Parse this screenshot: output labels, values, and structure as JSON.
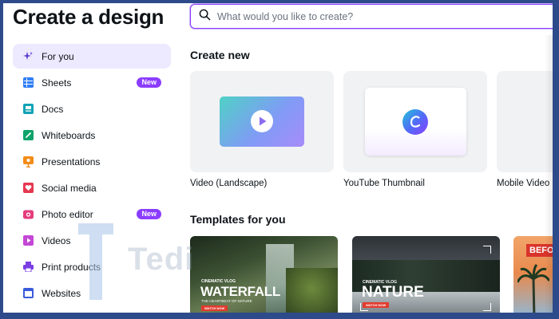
{
  "page": {
    "title": "Create a design"
  },
  "search": {
    "placeholder": "What would you like to create?"
  },
  "sidebar": {
    "items": [
      {
        "label": "For you",
        "icon": "sparkle-icon",
        "active": true
      },
      {
        "label": "Sheets",
        "icon": "sheets-icon",
        "badge": "New"
      },
      {
        "label": "Docs",
        "icon": "docs-icon"
      },
      {
        "label": "Whiteboards",
        "icon": "whiteboard-icon"
      },
      {
        "label": "Presentations",
        "icon": "presentation-icon"
      },
      {
        "label": "Social media",
        "icon": "heart-icon"
      },
      {
        "label": "Photo editor",
        "icon": "camera-icon",
        "badge": "New"
      },
      {
        "label": "Videos",
        "icon": "video-icon"
      },
      {
        "label": "Print products",
        "icon": "printer-icon"
      },
      {
        "label": "Websites",
        "icon": "website-icon"
      }
    ]
  },
  "create_new": {
    "heading": "Create new",
    "cards": [
      {
        "label": "Video (Landscape)"
      },
      {
        "label": "YouTube Thumbnail"
      },
      {
        "label": "Mobile Video"
      }
    ]
  },
  "templates": {
    "heading": "Templates for you",
    "items": [
      {
        "kicker": "CINEMATIC VLOG",
        "title": "WATERFALL",
        "subtitle": "THE HEARTBEAT OF NATURE",
        "cta": "WATCH NOW"
      },
      {
        "kicker": "CINEMATIC VLOG",
        "title": "NATURE",
        "cta": "WATCH NOW"
      },
      {
        "title": "BEFO"
      }
    ]
  },
  "colors": {
    "accent": "#8b3dff",
    "active_bg": "#ede9fe",
    "card_bg": "#f1f2f4",
    "badge_bg": "#8b3dff"
  }
}
